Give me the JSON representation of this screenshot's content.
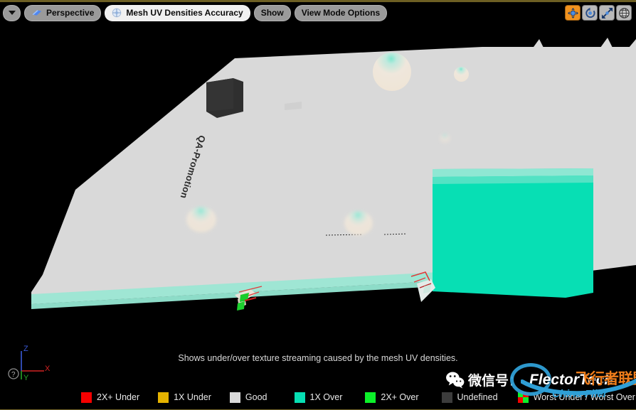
{
  "toolbar": {
    "dropdown_icon": "chevron-down-icon",
    "perspective": {
      "label": "Perspective",
      "icon": "camera-perspective-icon"
    },
    "view_mode": {
      "label": "Mesh UV Densities Accuracy",
      "icon": "viewmode-target-icon"
    },
    "show": {
      "label": "Show"
    },
    "view_mode_options": {
      "label": "View Mode Options"
    },
    "gizmos": [
      {
        "name": "translate-gizmo",
        "icon": "move-arrows-icon",
        "active": true
      },
      {
        "name": "rotate-gizmo",
        "icon": "rotate-arrow-icon",
        "active": false
      },
      {
        "name": "scale-gizmo",
        "icon": "scale-arrow-icon",
        "active": false
      },
      {
        "name": "world-space-gizmo",
        "icon": "globe-icon",
        "active": false
      }
    ]
  },
  "viewport": {
    "description": "Shows under/over texture streaming caused by the mesh UV densities.",
    "floor_label": "QA-Promotion",
    "axis_gizmo": {
      "x_label": "X",
      "y_label": "Y",
      "z_label": "Z",
      "help_label": "?",
      "x_color": "#d32222",
      "y_color": "#29a329",
      "z_color": "#3a5ad8"
    }
  },
  "legend": {
    "items": [
      {
        "label": "2X+ Under",
        "color": "#f40000"
      },
      {
        "label": "1X Under",
        "color": "#e5b300"
      },
      {
        "label": "Good",
        "color": "#d9d9d9"
      },
      {
        "label": "1X Over",
        "color": "#07dfb4"
      },
      {
        "label": "2X+ Over",
        "color": "#0cf12a"
      },
      {
        "label": "Undefined",
        "color": "#3c3c3c"
      },
      {
        "label": "Worst Under / Worst Over",
        "color": "#f40000",
        "color2": "#0cf12a",
        "pattern": "checker"
      }
    ]
  },
  "watermark": {
    "wechat_icon": "wechat-logo-icon",
    "wechat_label": "微信号：",
    "brand": "FlectorTech",
    "brand_cn": "飞行者联盟",
    "sub": "China Flier",
    "ring_color": "#2f9fd6",
    "orange_color": "#ef7d1a"
  },
  "colors": {
    "floor": "#d9d9d9",
    "floor_edge": "#9fe6d4",
    "teal_wall": "#07dfb4",
    "dark_block": "#2f2f2f",
    "rubble_dark": "#333333",
    "background": "#000000",
    "viewport_border": "#6d5f23"
  }
}
